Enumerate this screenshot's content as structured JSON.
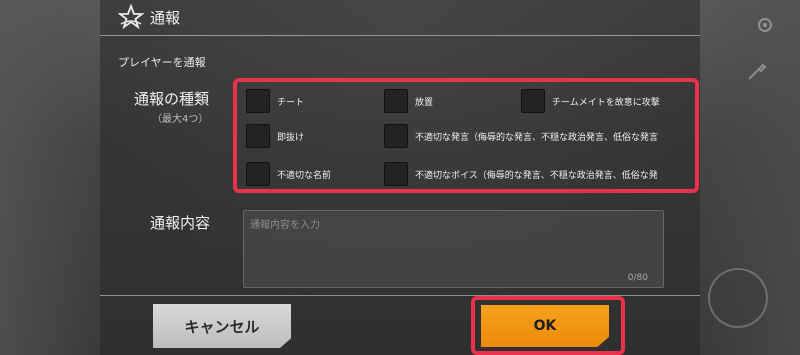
{
  "dialog": {
    "title": "通報",
    "subheading": "プレイヤーを通報"
  },
  "report_types": {
    "label": "通報の種類",
    "sublabel": "（最大4つ）",
    "options": [
      {
        "label": "チート",
        "checked": false
      },
      {
        "label": "放置",
        "checked": false
      },
      {
        "label": "チームメイトを故意に攻撃",
        "checked": false
      },
      {
        "label": "即抜け",
        "checked": false
      },
      {
        "label": "不適切な発言（侮辱的な発言、不穏な政治発言、低俗な発言",
        "checked": false
      },
      {
        "label": "不適切な名前",
        "checked": false
      },
      {
        "label": "不適切なボイス（侮辱的な発言、不穏な政治発言、低俗な発",
        "checked": false
      }
    ]
  },
  "content": {
    "label": "通報内容",
    "placeholder": "通報内容を入力",
    "counter": "0/80"
  },
  "buttons": {
    "cancel": "キャンセル",
    "ok": "OK"
  },
  "colors": {
    "highlight": "#e8334a",
    "ok_button": "#f29414",
    "cancel_button": "#cfcfcf"
  },
  "icons": [
    "emblem-icon",
    "settings-icon",
    "wrench-icon",
    "fist-icon"
  ]
}
